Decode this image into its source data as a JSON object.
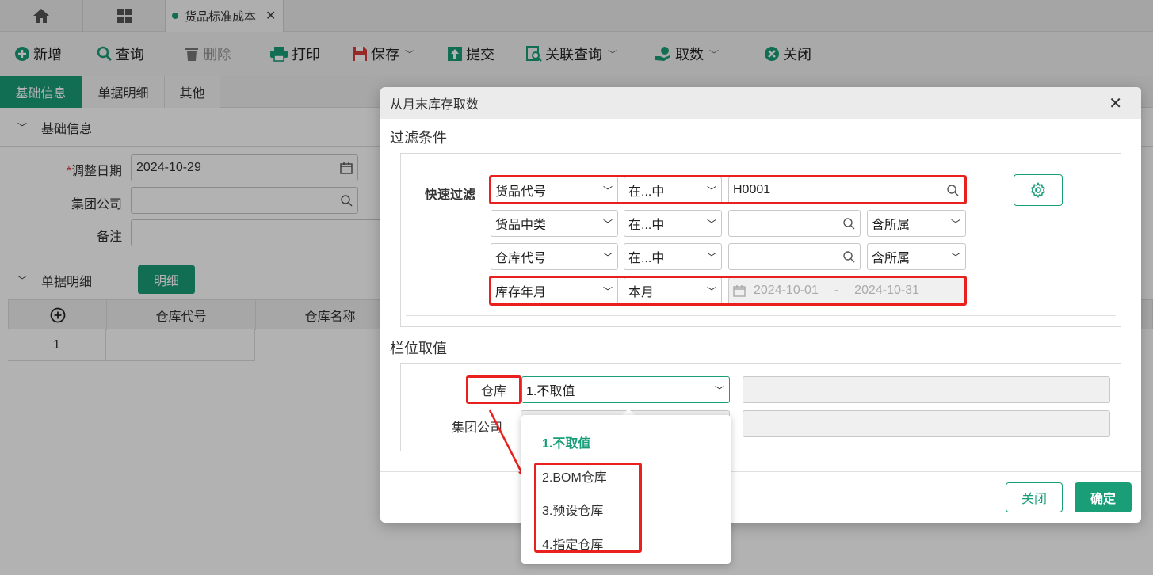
{
  "tabs": {
    "doc_tab_label": "货品标准成本"
  },
  "toolbar": {
    "add": "新增",
    "query": "查询",
    "delete": "删除",
    "print": "打印",
    "save": "保存",
    "submit": "提交",
    "related_query": "关联查询",
    "fetch": "取数",
    "close": "关闭"
  },
  "subtabs": {
    "basic": "基础信息",
    "detail": "单据明细",
    "other": "其他"
  },
  "basic_section": {
    "title": "基础信息",
    "date_label": "调整日期",
    "date_value": "2024-10-29",
    "company_label": "集团公司",
    "remark_label": "备注"
  },
  "detail_section": {
    "title": "单据明细",
    "detail_button": "明细",
    "columns": [
      "仓库代号",
      "仓库名称"
    ],
    "row_number": "1"
  },
  "dialog": {
    "title": "从月末库存取数",
    "filter_title": "过滤条件",
    "quick_filter_label": "快速过滤",
    "rows": [
      {
        "field": "货品代号",
        "op": "在...中",
        "value": "H0001"
      },
      {
        "field": "货品中类",
        "op": "在...中",
        "value": "",
        "scope": "含所属"
      },
      {
        "field": "仓库代号",
        "op": "在...中",
        "value": "",
        "scope": "含所属"
      },
      {
        "field": "库存年月",
        "op": "本月",
        "date_from": "2024-10-01",
        "date_sep": "-",
        "date_to": "2024-10-31"
      }
    ],
    "column_title": "栏位取值",
    "warehouse_label": "仓库",
    "warehouse_value": "1.不取值",
    "company_label": "集团公司",
    "options": [
      "1.不取值",
      "2.BOM仓库",
      "3.预设仓库",
      "4.指定仓库"
    ],
    "close_button": "关闭",
    "confirm_button": "确定"
  },
  "colors": {
    "accent": "#1a9e78",
    "highlight": "#e8201e"
  }
}
